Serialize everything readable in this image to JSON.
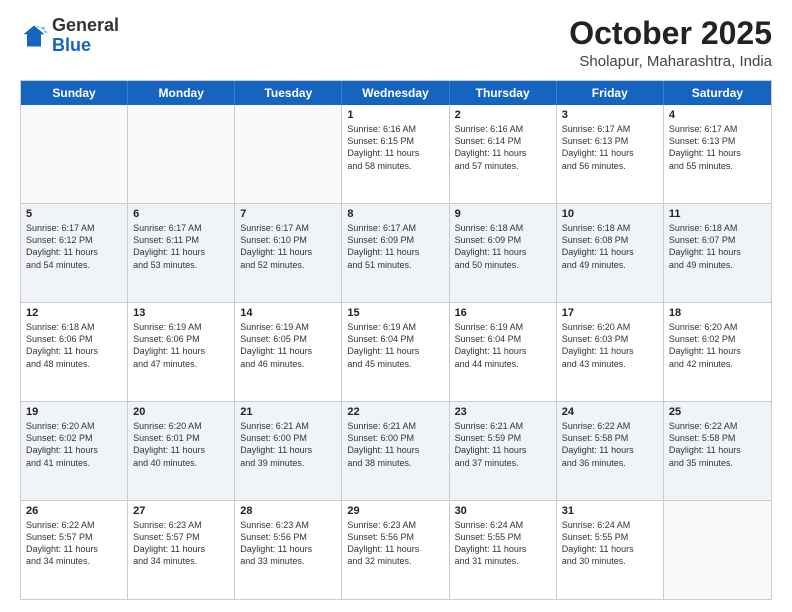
{
  "logo": {
    "general": "General",
    "blue": "Blue"
  },
  "title": "October 2025",
  "location": "Sholapur, Maharashtra, India",
  "days_of_week": [
    "Sunday",
    "Monday",
    "Tuesday",
    "Wednesday",
    "Thursday",
    "Friday",
    "Saturday"
  ],
  "weeks": [
    [
      {
        "day": "",
        "info": ""
      },
      {
        "day": "",
        "info": ""
      },
      {
        "day": "",
        "info": ""
      },
      {
        "day": "1",
        "info": "Sunrise: 6:16 AM\nSunset: 6:15 PM\nDaylight: 11 hours\nand 58 minutes."
      },
      {
        "day": "2",
        "info": "Sunrise: 6:16 AM\nSunset: 6:14 PM\nDaylight: 11 hours\nand 57 minutes."
      },
      {
        "day": "3",
        "info": "Sunrise: 6:17 AM\nSunset: 6:13 PM\nDaylight: 11 hours\nand 56 minutes."
      },
      {
        "day": "4",
        "info": "Sunrise: 6:17 AM\nSunset: 6:13 PM\nDaylight: 11 hours\nand 55 minutes."
      }
    ],
    [
      {
        "day": "5",
        "info": "Sunrise: 6:17 AM\nSunset: 6:12 PM\nDaylight: 11 hours\nand 54 minutes."
      },
      {
        "day": "6",
        "info": "Sunrise: 6:17 AM\nSunset: 6:11 PM\nDaylight: 11 hours\nand 53 minutes."
      },
      {
        "day": "7",
        "info": "Sunrise: 6:17 AM\nSunset: 6:10 PM\nDaylight: 11 hours\nand 52 minutes."
      },
      {
        "day": "8",
        "info": "Sunrise: 6:17 AM\nSunset: 6:09 PM\nDaylight: 11 hours\nand 51 minutes."
      },
      {
        "day": "9",
        "info": "Sunrise: 6:18 AM\nSunset: 6:09 PM\nDaylight: 11 hours\nand 50 minutes."
      },
      {
        "day": "10",
        "info": "Sunrise: 6:18 AM\nSunset: 6:08 PM\nDaylight: 11 hours\nand 49 minutes."
      },
      {
        "day": "11",
        "info": "Sunrise: 6:18 AM\nSunset: 6:07 PM\nDaylight: 11 hours\nand 49 minutes."
      }
    ],
    [
      {
        "day": "12",
        "info": "Sunrise: 6:18 AM\nSunset: 6:06 PM\nDaylight: 11 hours\nand 48 minutes."
      },
      {
        "day": "13",
        "info": "Sunrise: 6:19 AM\nSunset: 6:06 PM\nDaylight: 11 hours\nand 47 minutes."
      },
      {
        "day": "14",
        "info": "Sunrise: 6:19 AM\nSunset: 6:05 PM\nDaylight: 11 hours\nand 46 minutes."
      },
      {
        "day": "15",
        "info": "Sunrise: 6:19 AM\nSunset: 6:04 PM\nDaylight: 11 hours\nand 45 minutes."
      },
      {
        "day": "16",
        "info": "Sunrise: 6:19 AM\nSunset: 6:04 PM\nDaylight: 11 hours\nand 44 minutes."
      },
      {
        "day": "17",
        "info": "Sunrise: 6:20 AM\nSunset: 6:03 PM\nDaylight: 11 hours\nand 43 minutes."
      },
      {
        "day": "18",
        "info": "Sunrise: 6:20 AM\nSunset: 6:02 PM\nDaylight: 11 hours\nand 42 minutes."
      }
    ],
    [
      {
        "day": "19",
        "info": "Sunrise: 6:20 AM\nSunset: 6:02 PM\nDaylight: 11 hours\nand 41 minutes."
      },
      {
        "day": "20",
        "info": "Sunrise: 6:20 AM\nSunset: 6:01 PM\nDaylight: 11 hours\nand 40 minutes."
      },
      {
        "day": "21",
        "info": "Sunrise: 6:21 AM\nSunset: 6:00 PM\nDaylight: 11 hours\nand 39 minutes."
      },
      {
        "day": "22",
        "info": "Sunrise: 6:21 AM\nSunset: 6:00 PM\nDaylight: 11 hours\nand 38 minutes."
      },
      {
        "day": "23",
        "info": "Sunrise: 6:21 AM\nSunset: 5:59 PM\nDaylight: 11 hours\nand 37 minutes."
      },
      {
        "day": "24",
        "info": "Sunrise: 6:22 AM\nSunset: 5:58 PM\nDaylight: 11 hours\nand 36 minutes."
      },
      {
        "day": "25",
        "info": "Sunrise: 6:22 AM\nSunset: 5:58 PM\nDaylight: 11 hours\nand 35 minutes."
      }
    ],
    [
      {
        "day": "26",
        "info": "Sunrise: 6:22 AM\nSunset: 5:57 PM\nDaylight: 11 hours\nand 34 minutes."
      },
      {
        "day": "27",
        "info": "Sunrise: 6:23 AM\nSunset: 5:57 PM\nDaylight: 11 hours\nand 34 minutes."
      },
      {
        "day": "28",
        "info": "Sunrise: 6:23 AM\nSunset: 5:56 PM\nDaylight: 11 hours\nand 33 minutes."
      },
      {
        "day": "29",
        "info": "Sunrise: 6:23 AM\nSunset: 5:56 PM\nDaylight: 11 hours\nand 32 minutes."
      },
      {
        "day": "30",
        "info": "Sunrise: 6:24 AM\nSunset: 5:55 PM\nDaylight: 11 hours\nand 31 minutes."
      },
      {
        "day": "31",
        "info": "Sunrise: 6:24 AM\nSunset: 5:55 PM\nDaylight: 11 hours\nand 30 minutes."
      },
      {
        "day": "",
        "info": ""
      }
    ]
  ]
}
